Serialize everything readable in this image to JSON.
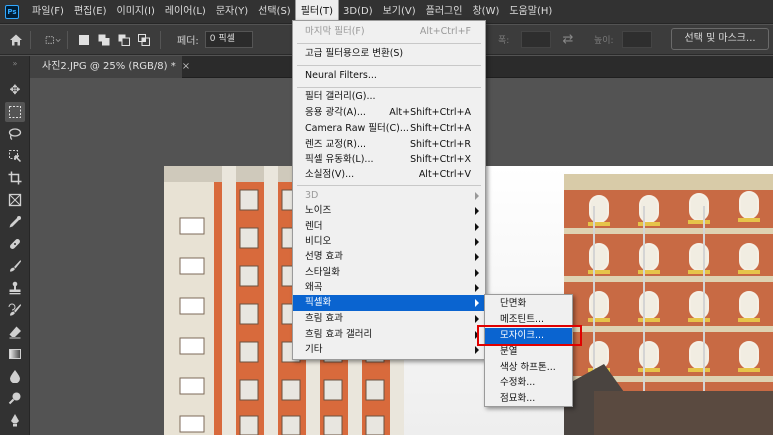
{
  "app": {
    "logo": "Ps"
  },
  "menubar": {
    "items": [
      "파일(F)",
      "편집(E)",
      "이미지(I)",
      "레이어(L)",
      "문자(Y)",
      "선택(S)",
      "필터(T)",
      "3D(D)",
      "보기(V)",
      "플러그인",
      "창(W)",
      "도움말(H)"
    ],
    "active_index": 6
  },
  "options": {
    "feather_label": "페더:",
    "feather_value": "0 픽셀",
    "width_label": "폭:",
    "height_label": "높이:",
    "select_mask_button": "선택 및 마스크..."
  },
  "document": {
    "tab_title": "사진2.JPG @ 25% (RGB/8) *",
    "close": "×"
  },
  "filter_menu": {
    "last_filter": {
      "label": "마지막 필터(F)",
      "shortcut": "Alt+Ctrl+F"
    },
    "convert_smart": "고급 필터용으로 변환(S)",
    "neural": "Neural Filters...",
    "gallery": "필터 갤러리(G)...",
    "adaptive_wide": {
      "label": "응용 광각(A)...",
      "shortcut": "Alt+Shift+Ctrl+A"
    },
    "camera_raw": {
      "label": "Camera Raw 필터(C)...",
      "shortcut": "Shift+Ctrl+A"
    },
    "lens_correction": {
      "label": "렌즈 교정(R)...",
      "shortcut": "Shift+Ctrl+R"
    },
    "liquify": {
      "label": "픽셀 유동화(L)...",
      "shortcut": "Shift+Ctrl+X"
    },
    "vanishing_point": {
      "label": "소실점(V)...",
      "shortcut": "Alt+Ctrl+V"
    },
    "submenus": [
      "3D",
      "노이즈",
      "렌더",
      "비디오",
      "선명 효과",
      "스타일화",
      "왜곡",
      "픽셀화",
      "흐림 효과",
      "흐림 효과 갤러리",
      "기타"
    ]
  },
  "pixelate_submenu": {
    "items": [
      "단면화",
      "메조틴트...",
      "모자이크...",
      "분열",
      "색상 하프톤...",
      "수정화...",
      "점묘화..."
    ],
    "hover_index": 2
  }
}
